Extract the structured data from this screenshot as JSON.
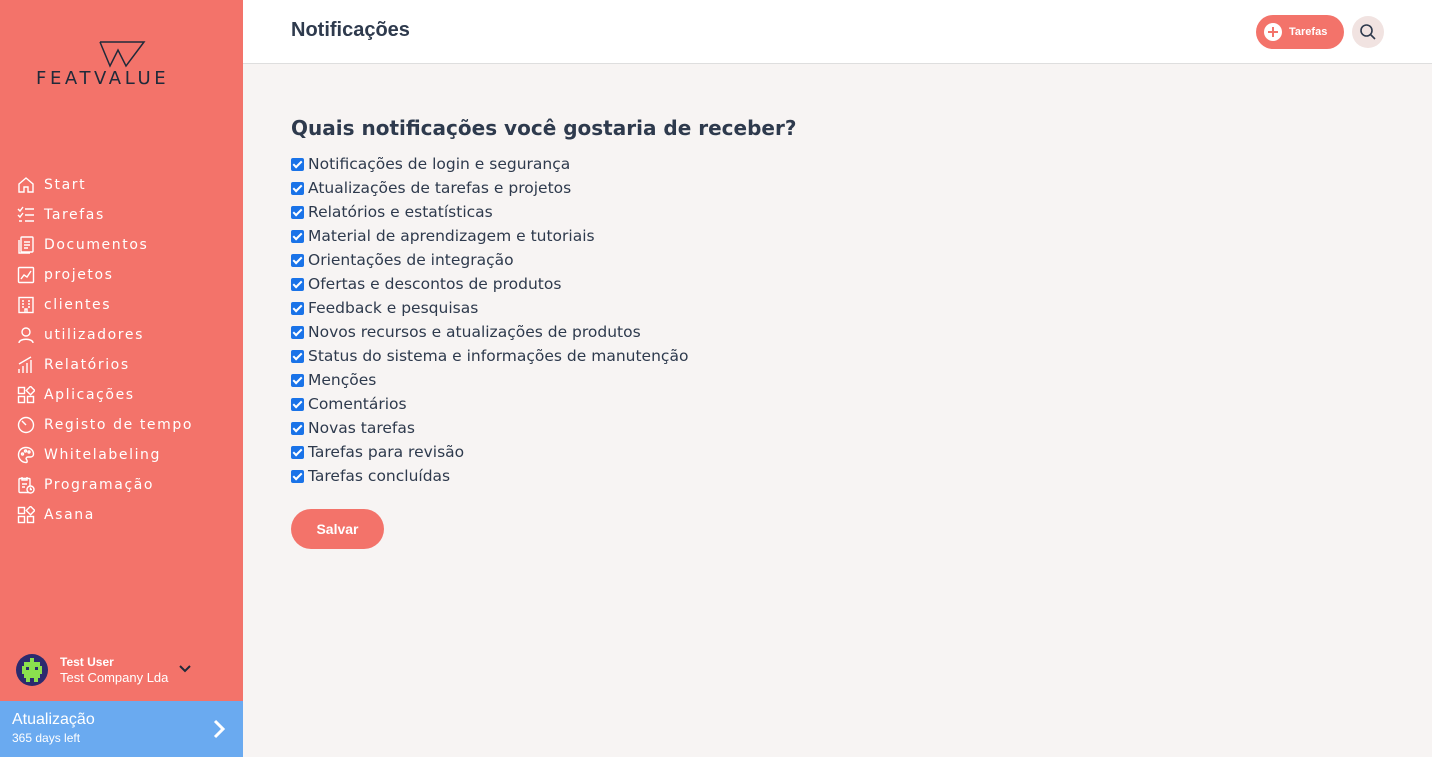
{
  "app": {
    "logo_text": "FEATVALUE",
    "brand_color": "#f3736a",
    "accent_blue": "#6aaaf0",
    "text_color": "#2e3a4d"
  },
  "sidebar": {
    "items": [
      {
        "label": "Start",
        "icon": "home-icon"
      },
      {
        "label": "Tarefas",
        "icon": "task-list-icon"
      },
      {
        "label": "Documentos",
        "icon": "documents-icon"
      },
      {
        "label": "projetos",
        "icon": "chart-icon"
      },
      {
        "label": "clientes",
        "icon": "building-icon"
      },
      {
        "label": "utilizadores",
        "icon": "user-icon"
      },
      {
        "label": "Relatórios",
        "icon": "bar-chart-icon"
      },
      {
        "label": "Aplicações",
        "icon": "apps-grid-icon"
      },
      {
        "label": "Registo de tempo",
        "icon": "timer-icon"
      },
      {
        "label": "Whitelabeling",
        "icon": "palette-icon"
      },
      {
        "label": "Programação",
        "icon": "schedule-icon"
      },
      {
        "label": "Asana",
        "icon": "apps-grid-icon"
      }
    ],
    "user": {
      "name": "Test User",
      "company": "Test Company Lda"
    },
    "upgrade": {
      "title": "Atualização",
      "subtitle": "365 days left"
    }
  },
  "header": {
    "title": "Notificações",
    "tasks_button": "Tarefas",
    "search_icon": "search-icon"
  },
  "main": {
    "question": "Quais notificações você gostaria de receber?",
    "options": [
      {
        "label": "Notificações de login e segurança",
        "checked": true
      },
      {
        "label": "Atualizações de tarefas e projetos",
        "checked": true
      },
      {
        "label": "Relatórios e estatísticas",
        "checked": true
      },
      {
        "label": "Material de aprendizagem e tutoriais",
        "checked": true
      },
      {
        "label": "Orientações de integração",
        "checked": true
      },
      {
        "label": "Ofertas e descontos de produtos",
        "checked": true
      },
      {
        "label": "Feedback e pesquisas",
        "checked": true
      },
      {
        "label": "Novos recursos e atualizações de produtos",
        "checked": true
      },
      {
        "label": "Status do sistema e informações de manutenção",
        "checked": true
      },
      {
        "label": "Menções",
        "checked": true
      },
      {
        "label": "Comentários",
        "checked": true
      },
      {
        "label": "Novas tarefas",
        "checked": true
      },
      {
        "label": "Tarefas para revisão",
        "checked": true
      },
      {
        "label": "Tarefas concluídas",
        "checked": true
      }
    ],
    "save_label": "Salvar"
  }
}
